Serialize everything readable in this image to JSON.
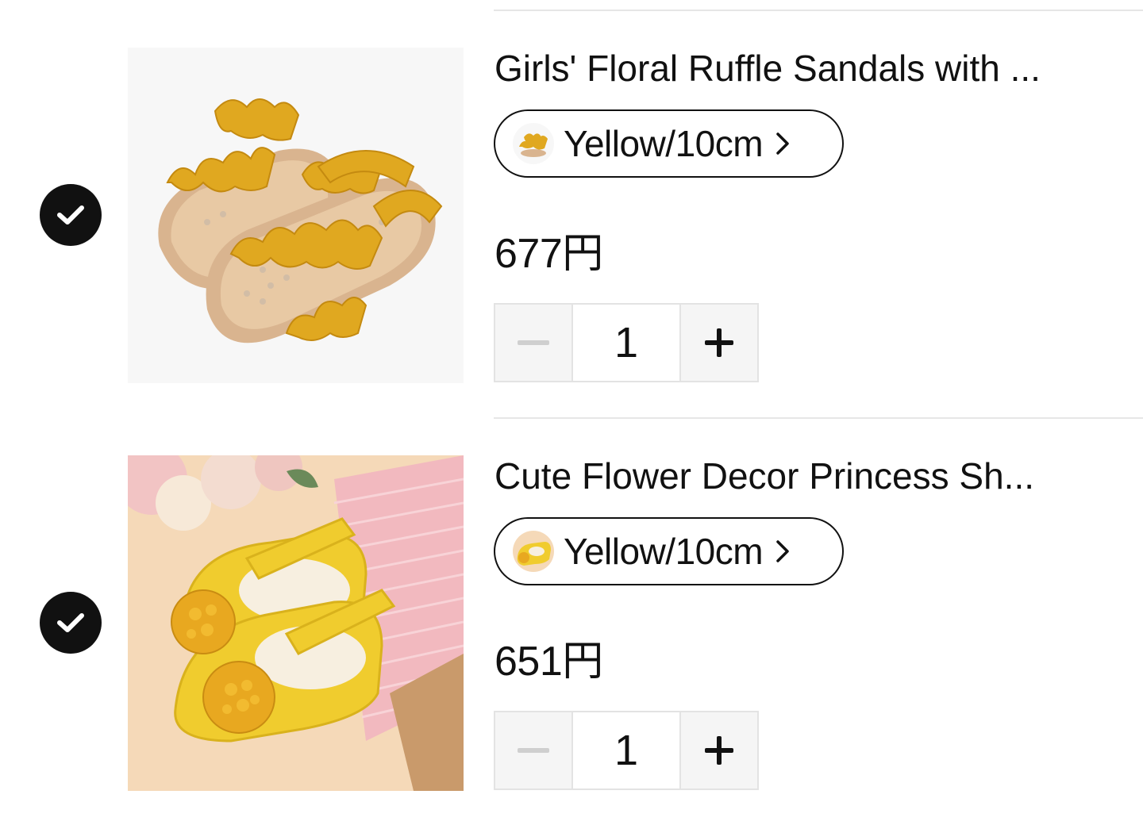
{
  "cart": {
    "items": [
      {
        "title": "Girls' Floral Ruffle Sandals with ...",
        "variant": "Yellow/10cm",
        "price": "677円",
        "quantity": "1",
        "selected": true
      },
      {
        "title": "Cute Flower Decor Princess Sh...",
        "variant": "Yellow/10cm",
        "price": "651円",
        "quantity": "1",
        "selected": true
      }
    ]
  },
  "icons": {
    "check": "check-circle-icon",
    "chevron": "chevron-right-icon",
    "minus": "minus-icon",
    "plus": "plus-icon"
  },
  "colors": {
    "text": "#111111",
    "divider": "#e6e6e6",
    "stepper_bg": "#f5f5f5",
    "product_yellow": "#e0a820"
  }
}
